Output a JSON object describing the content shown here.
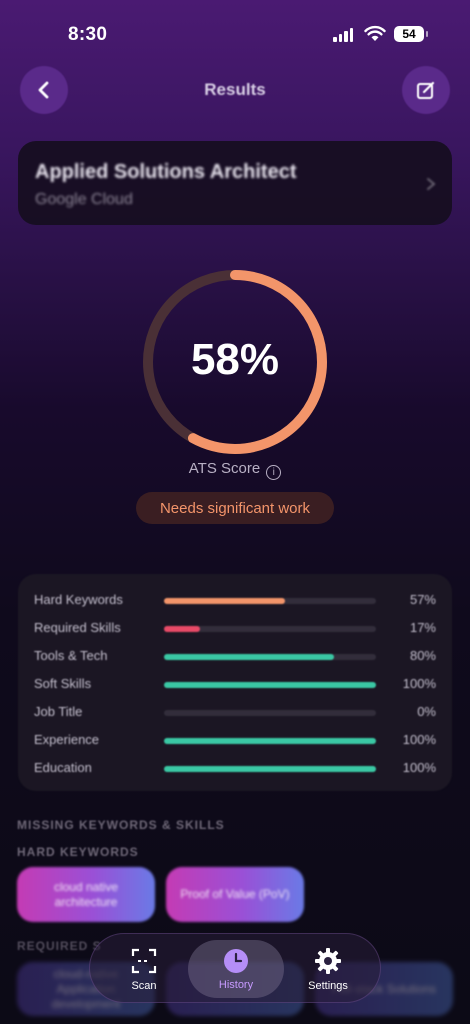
{
  "status_bar": {
    "time": "8:30",
    "battery": "54"
  },
  "header": {
    "title": "Results"
  },
  "job": {
    "title": "Applied Solutions Architect",
    "company": "Google Cloud"
  },
  "score": {
    "value": 58,
    "display": "58%",
    "label": "ATS Score",
    "verdict": "Needs significant work",
    "colors": {
      "progress": "#f3956a",
      "track": "#4a3036"
    }
  },
  "breakdown": [
    {
      "label": "Hard Keywords",
      "value": "57%",
      "fraction": 0.57,
      "color": "#f3956a"
    },
    {
      "label": "Required Skills",
      "value": "17%",
      "fraction": 0.17,
      "color": "#e84a67"
    },
    {
      "label": "Tools & Tech",
      "value": "80%",
      "fraction": 0.8,
      "color": "#3ac8a4"
    },
    {
      "label": "Soft Skills",
      "value": "100%",
      "fraction": 1.0,
      "color": "#3ac8a4"
    },
    {
      "label": "Job Title",
      "value": "0%",
      "fraction": 0.0,
      "color": "#3ac8a4"
    },
    {
      "label": "Experience",
      "value": "100%",
      "fraction": 1.0,
      "color": "#3ac8a4"
    },
    {
      "label": "Education",
      "value": "100%",
      "fraction": 1.0,
      "color": "#3ac8a4"
    }
  ],
  "missing": {
    "section_title": "MISSING KEYWORDS & SKILLS",
    "hard_keywords_title": "HARD KEYWORDS",
    "hard_keywords": [
      "cloud native architecture",
      "Proof of Value (PoV)"
    ],
    "required_skills_title": "REQUIRED S",
    "required_skills": [
      "cloud-native Application development",
      "",
      "Full-stack Solutions"
    ]
  },
  "tabs": [
    {
      "label": "Scan",
      "icon": "scan-icon",
      "active": false
    },
    {
      "label": "History",
      "icon": "clock-icon",
      "active": true
    },
    {
      "label": "Settings",
      "icon": "gear-icon",
      "active": false
    }
  ]
}
